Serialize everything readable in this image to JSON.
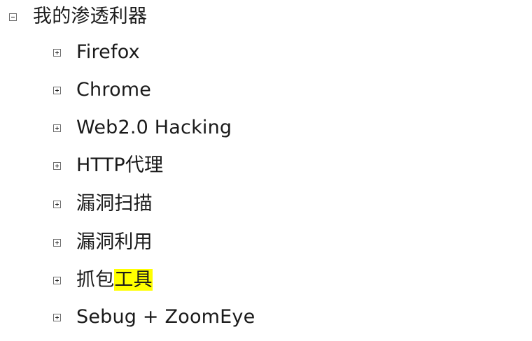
{
  "tree": {
    "root": {
      "label": "我的渗透利器",
      "expanded": true,
      "toggle_icon": "collapse-minus-icon"
    },
    "children": [
      {
        "label": "Firefox",
        "expanded": false,
        "toggle_icon": "expand-plus-icon"
      },
      {
        "label": "Chrome",
        "expanded": false,
        "toggle_icon": "expand-plus-icon"
      },
      {
        "label": "Web2.0 Hacking",
        "expanded": false,
        "toggle_icon": "expand-plus-icon"
      },
      {
        "label": "HTTP代理",
        "expanded": false,
        "toggle_icon": "expand-plus-icon"
      },
      {
        "label": "漏洞扫描",
        "expanded": false,
        "toggle_icon": "expand-plus-icon"
      },
      {
        "label": "漏洞利用",
        "expanded": false,
        "toggle_icon": "expand-plus-icon"
      },
      {
        "label_plain": "抓包",
        "label_highlighted": "工具",
        "highlight_color": "#ffff00",
        "expanded": false,
        "toggle_icon": "expand-plus-icon"
      },
      {
        "label": "Sebug + ZoomEye",
        "expanded": false,
        "toggle_icon": "expand-plus-icon"
      }
    ]
  }
}
